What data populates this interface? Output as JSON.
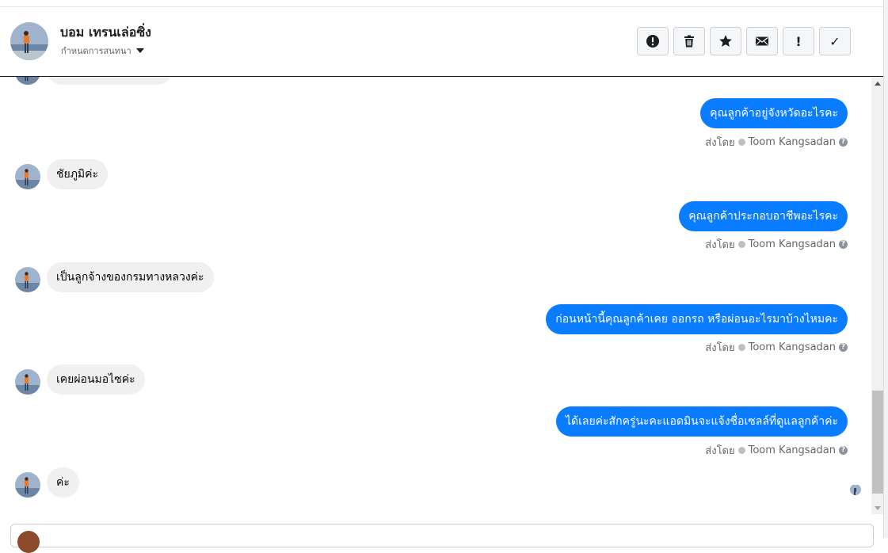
{
  "header": {
    "contact_name": "บอม เทรนเล่อซิ่ง",
    "assign_label": "กำหนดการสนทนา",
    "actions": [
      {
        "name": "spam-button",
        "icon": "alert-circle-icon"
      },
      {
        "name": "delete-button",
        "icon": "trash-icon"
      },
      {
        "name": "star-button",
        "icon": "star-icon"
      },
      {
        "name": "mark-unread-button",
        "icon": "envelope-icon"
      },
      {
        "name": "follow-up-button",
        "icon": "exclamation-icon",
        "glyph": "!"
      },
      {
        "name": "mark-done-button",
        "icon": "check-icon",
        "glyph": "✓"
      }
    ]
  },
  "conversation": {
    "sent_by_prefix": "ส่งโดย",
    "agent_name": "Toom Kangsadan",
    "info_glyph": "?",
    "messages": [
      {
        "dir": "out",
        "text": "คุณลูกค้าอยู่จังหวัดอะไรคะ"
      },
      {
        "dir": "in",
        "text": "ชัยภูมิค่ะ"
      },
      {
        "dir": "out",
        "text": "คุณลูกค้าประกอบอาชีพอะไรคะ"
      },
      {
        "dir": "in",
        "text": "เป็นลูกจ้างของกรมทางหลวงค่ะ"
      },
      {
        "dir": "out",
        "text": "ก่อนหน้านี้คุณลูกค้าเคย ออกรถ หรือผ่อนอะไรมาบ้างไหมคะ"
      },
      {
        "dir": "in",
        "text": "เคยผ่อนมอไซค่ะ"
      },
      {
        "dir": "out",
        "text": "ได้เลยค่ะสักครู่นะคะแอดมินจะแจ้งชื่อเซลล์ที่ดูแลลูกค้าค่ะ"
      },
      {
        "dir": "in",
        "text": "ค่ะ"
      }
    ]
  },
  "colors": {
    "outgoing_bubble": "#0a7cff",
    "incoming_bubble": "#f0f0f0",
    "meta_text": "#65676b"
  }
}
